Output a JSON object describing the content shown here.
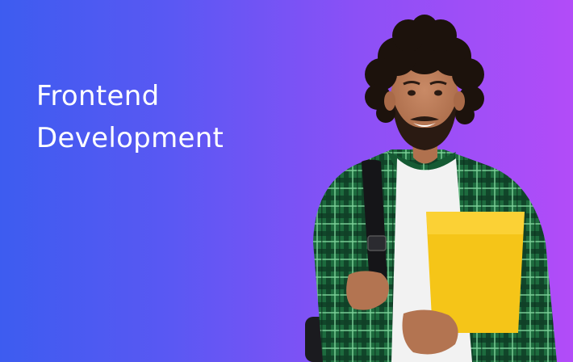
{
  "banner": {
    "title_line1": "Frontend",
    "title_line2": "Development",
    "colors": {
      "gradient_start": "#3d5cf0",
      "gradient_end": "#b24cf8",
      "shirt_green": "#1f7a45",
      "folder_yellow": "#f5c518"
    }
  }
}
